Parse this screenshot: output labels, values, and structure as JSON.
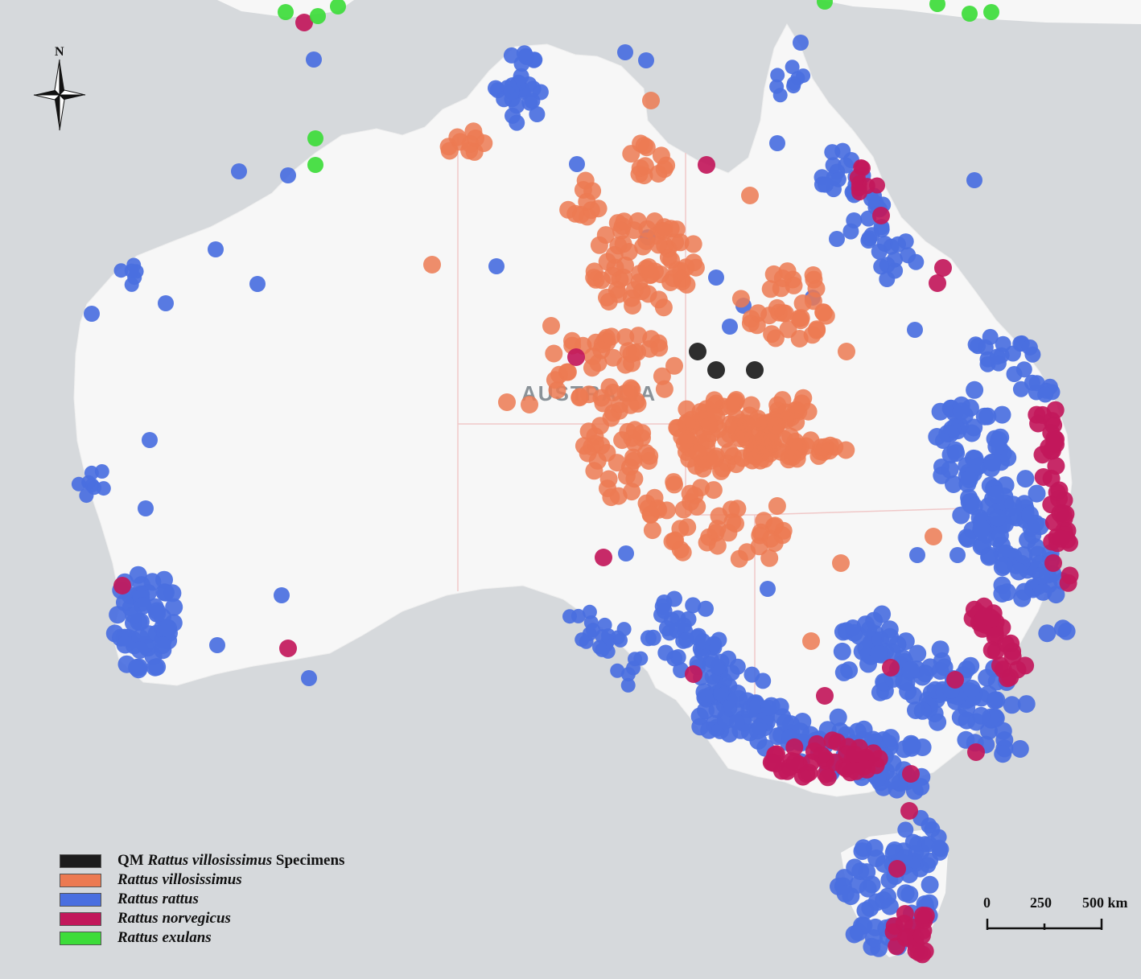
{
  "map": {
    "region_label": "AUSTRALIA",
    "north_label": "N",
    "colors": {
      "water": "#d6d9dc",
      "land": "#f7f7f7",
      "border": "#f0c8c8"
    }
  },
  "legend": {
    "items": [
      {
        "key": "qm",
        "prefix": "QM",
        "name": "Rattus villosissimus",
        "suffix": "Specimens",
        "color": "#1c1c1c"
      },
      {
        "key": "villosissimus",
        "prefix": "",
        "name": "Rattus villosissimus",
        "suffix": "",
        "color": "#ec7a52"
      },
      {
        "key": "rattus",
        "prefix": "",
        "name": "Rattus rattus",
        "suffix": "",
        "color": "#4a6fe0"
      },
      {
        "key": "norvegicus",
        "prefix": "",
        "name": "Rattus norvegicus",
        "suffix": "",
        "color": "#c2185b"
      },
      {
        "key": "exulans",
        "prefix": "",
        "name": "Rattus exulans",
        "suffix": "",
        "color": "#3ddc3a"
      }
    ]
  },
  "scale_bar": {
    "ticks": [
      "0",
      "250",
      "500 km"
    ]
  }
}
